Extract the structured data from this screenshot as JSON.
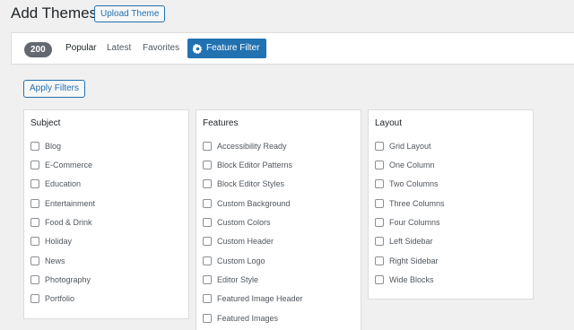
{
  "header": {
    "title": "Add Themes",
    "upload_label": "Upload Theme"
  },
  "filter_bar": {
    "count": "200",
    "links": [
      "Popular",
      "Latest",
      "Favorites"
    ],
    "feature_filter_label": "Feature Filter",
    "feature_filter_icon": "gear-icon"
  },
  "apply_filters_label": "Apply Filters",
  "groups": [
    {
      "title": "Subject",
      "options": [
        "Blog",
        "E-Commerce",
        "Education",
        "Entertainment",
        "Food & Drink",
        "Holiday",
        "News",
        "Photography",
        "Portfolio"
      ]
    },
    {
      "title": "Features",
      "options": [
        "Accessibility Ready",
        "Block Editor Patterns",
        "Block Editor Styles",
        "Custom Background",
        "Custom Colors",
        "Custom Header",
        "Custom Logo",
        "Editor Style",
        "Featured Image Header",
        "Featured Images"
      ]
    },
    {
      "title": "Layout",
      "options": [
        "Grid Layout",
        "One Column",
        "Two Columns",
        "Three Columns",
        "Four Columns",
        "Left Sidebar",
        "Right Sidebar",
        "Wide Blocks"
      ]
    }
  ],
  "colors": {
    "accent": "#2271b1",
    "badge": "#646970",
    "background": "#f0f0f1"
  }
}
